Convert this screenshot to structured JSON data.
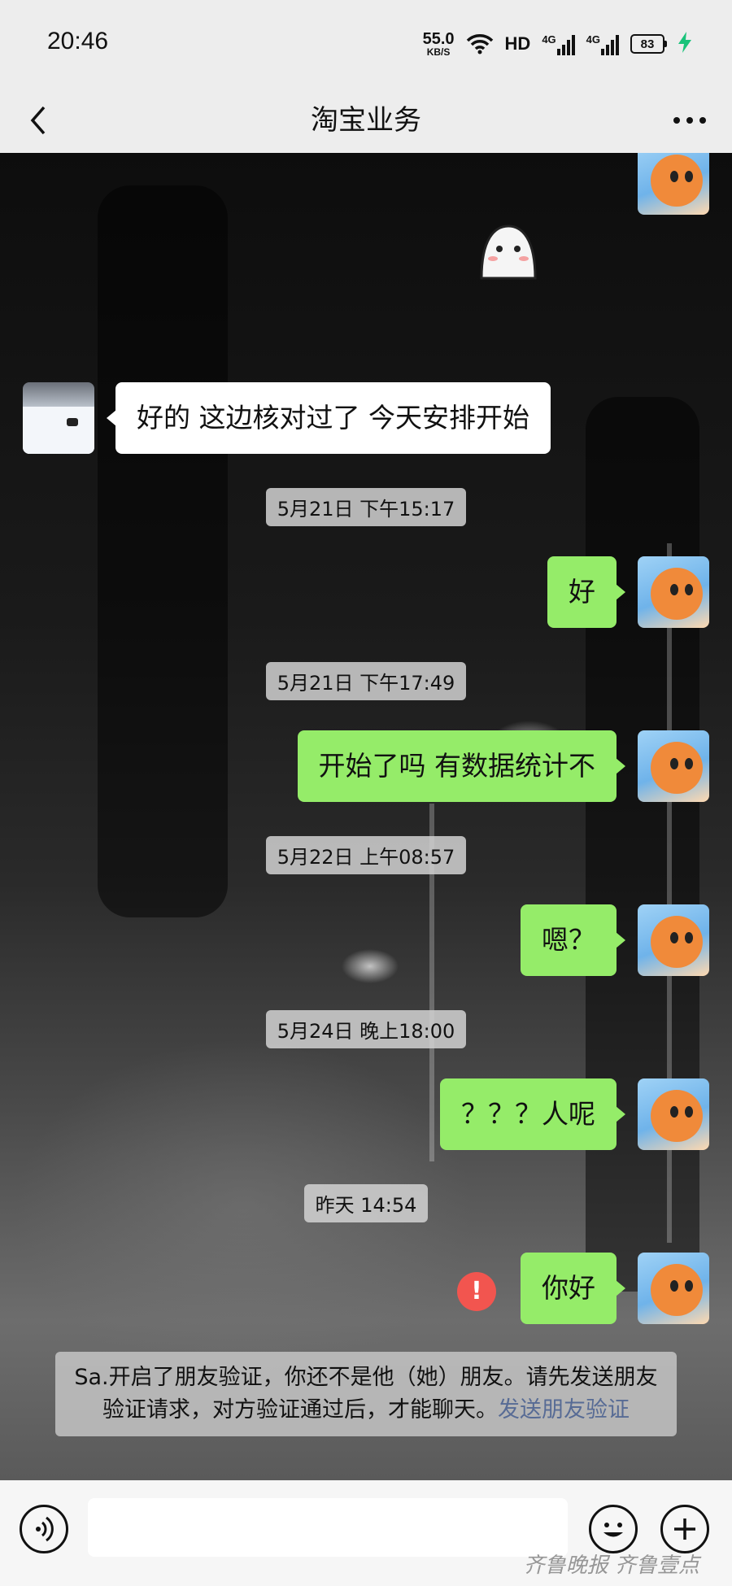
{
  "status_bar": {
    "time": "20:46",
    "net_speed": "55.0",
    "net_speed_unit": "KB/S",
    "hd_label": "HD",
    "signal1_tag": "4G",
    "signal2_tag": "4G",
    "battery": "83",
    "icons": [
      "wifi-icon",
      "signal-icon",
      "battery-icon",
      "charging-icon"
    ]
  },
  "header": {
    "title": "淘宝业务",
    "back_icon": "chevron-left-icon",
    "more_icon": "more-dots-icon",
    "background": "#ededed"
  },
  "messages": [
    {
      "type": "other_text",
      "text": "好的 这边核对过了 今天安排开始"
    },
    {
      "type": "timestamp",
      "text": "5月21日 下午15:17"
    },
    {
      "type": "mine_text",
      "text": "好"
    },
    {
      "type": "timestamp",
      "text": "5月21日 下午17:49"
    },
    {
      "type": "mine_text",
      "text": "开始了吗  有数据统计不"
    },
    {
      "type": "timestamp",
      "text": "5月22日 上午08:57"
    },
    {
      "type": "mine_text",
      "text": "嗯？"
    },
    {
      "type": "timestamp",
      "text": "5月24日 晚上18:00"
    },
    {
      "type": "mine_text",
      "text": "？？？人呢"
    },
    {
      "type": "timestamp",
      "text": "昨天 14:54"
    },
    {
      "type": "mine_text_failed",
      "text": "你好",
      "error_glyph": "!"
    }
  ],
  "notice": {
    "text": "Sa.开启了朋友验证，你还不是他（她）朋友。请先发送朋友验证请求，对方验证通过后，才能聊天。",
    "link_text": "发送朋友验证"
  },
  "input_bar": {
    "value": "",
    "voice_icon": "voice-icon",
    "emoji_icon": "emoji-icon",
    "plus_icon": "plus-icon"
  },
  "watermark": "齐鲁晚报 齐鲁壹点",
  "colors": {
    "mine_bubble": "#95ec69",
    "other_bubble": "#ffffff",
    "error": "#f2554f",
    "link": "#576b95"
  }
}
